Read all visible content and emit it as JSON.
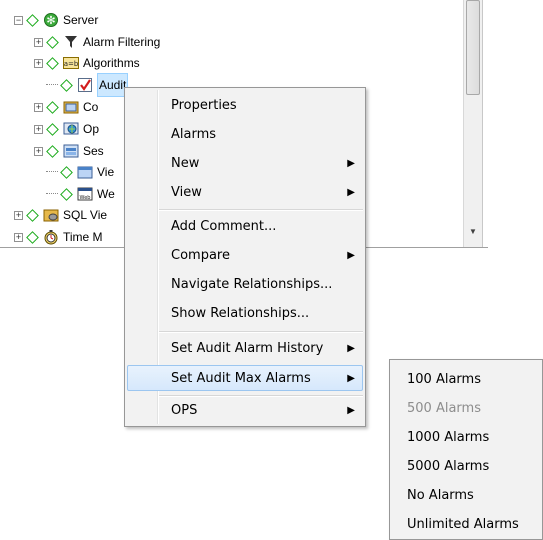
{
  "tree": {
    "items": [
      {
        "label": "Server",
        "icon": "server-gear-icon",
        "expander": "−"
      },
      {
        "label": "Alarm Filtering",
        "icon": "filter-funnel-icon",
        "expander": "+"
      },
      {
        "label": "Algorithms",
        "icon": "algorithm-icon",
        "expander": "+"
      },
      {
        "label": "Audit",
        "icon": "audit-checklist-icon",
        "expander": ""
      },
      {
        "label": "Co",
        "icon": "folder-window-icon",
        "expander": "+"
      },
      {
        "label": "Op",
        "icon": "globe-window-icon",
        "expander": "+"
      },
      {
        "label": "Ses",
        "icon": "session-window-icon",
        "expander": "+"
      },
      {
        "label": "Vie",
        "icon": "folder-view-icon",
        "expander": ""
      },
      {
        "label": "We",
        "icon": "web-icon",
        "expander": ""
      },
      {
        "label": "SQL Vie",
        "icon": "sql-view-icon",
        "expander": "+"
      },
      {
        "label": "Time M",
        "icon": "stopwatch-icon",
        "expander": "+"
      }
    ]
  },
  "context_menu": {
    "items": [
      {
        "label": "Properties",
        "submenu": false
      },
      {
        "label": "Alarms",
        "submenu": false
      },
      {
        "label": "New",
        "submenu": true
      },
      {
        "label": "View",
        "submenu": true
      },
      {
        "label": "Add Comment...",
        "submenu": false
      },
      {
        "label": "Compare",
        "submenu": true
      },
      {
        "label": "Navigate Relationships...",
        "submenu": false
      },
      {
        "label": "Show Relationships...",
        "submenu": false
      },
      {
        "label": "Set Audit Alarm History",
        "submenu": true
      },
      {
        "label": "Set Audit Max Alarms",
        "submenu": true
      },
      {
        "label": "OPS",
        "submenu": true
      }
    ],
    "arrow_glyph": "▶"
  },
  "submenu": {
    "items": [
      {
        "label": "100 Alarms",
        "enabled": true
      },
      {
        "label": "500 Alarms",
        "enabled": false
      },
      {
        "label": "1000 Alarms",
        "enabled": true
      },
      {
        "label": "5000 Alarms",
        "enabled": true
      },
      {
        "label": "No Alarms",
        "enabled": true
      },
      {
        "label": "Unlimited Alarms",
        "enabled": true
      }
    ]
  },
  "colors": {
    "diamond": "#1aaa1a",
    "selection": "#cce8ff",
    "menu_bg": "#f2f2f2",
    "hover_border": "#9cc6f0",
    "disabled_text": "#8d8d8d"
  }
}
